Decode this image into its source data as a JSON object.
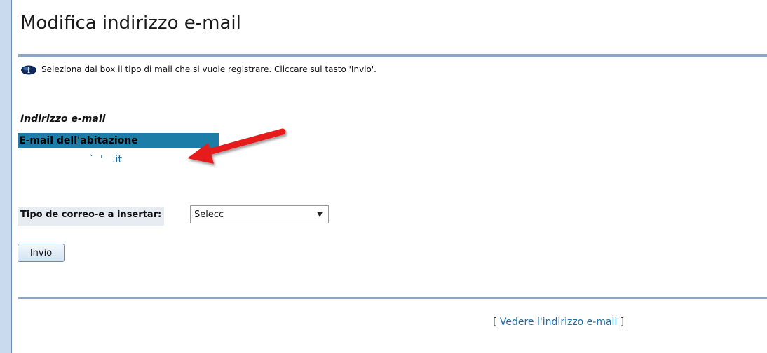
{
  "page": {
    "title": "Modifica indirizzo e-mail"
  },
  "info": {
    "message": "Seleziona dal box il tipo di mail che si vuole registrare. Cliccare sul tasto 'Invio'."
  },
  "email_section": {
    "heading": "Indirizzo e-mail",
    "type_label": "E-mail dell'abitazione",
    "address": "`  '   .it"
  },
  "form": {
    "type_label": "Tipo de correo-e a insertar:",
    "select_value": "Selecc",
    "submit_label": "Invio"
  },
  "footer": {
    "bracket_open": "[",
    "link_label": "Vedere l'indirizzo e-mail",
    "bracket_close": "]"
  },
  "colors": {
    "accent": "#1c7da8",
    "link": "#1a6ea8",
    "arrow": "#e61e1e",
    "rule": "#8ea6c2"
  }
}
